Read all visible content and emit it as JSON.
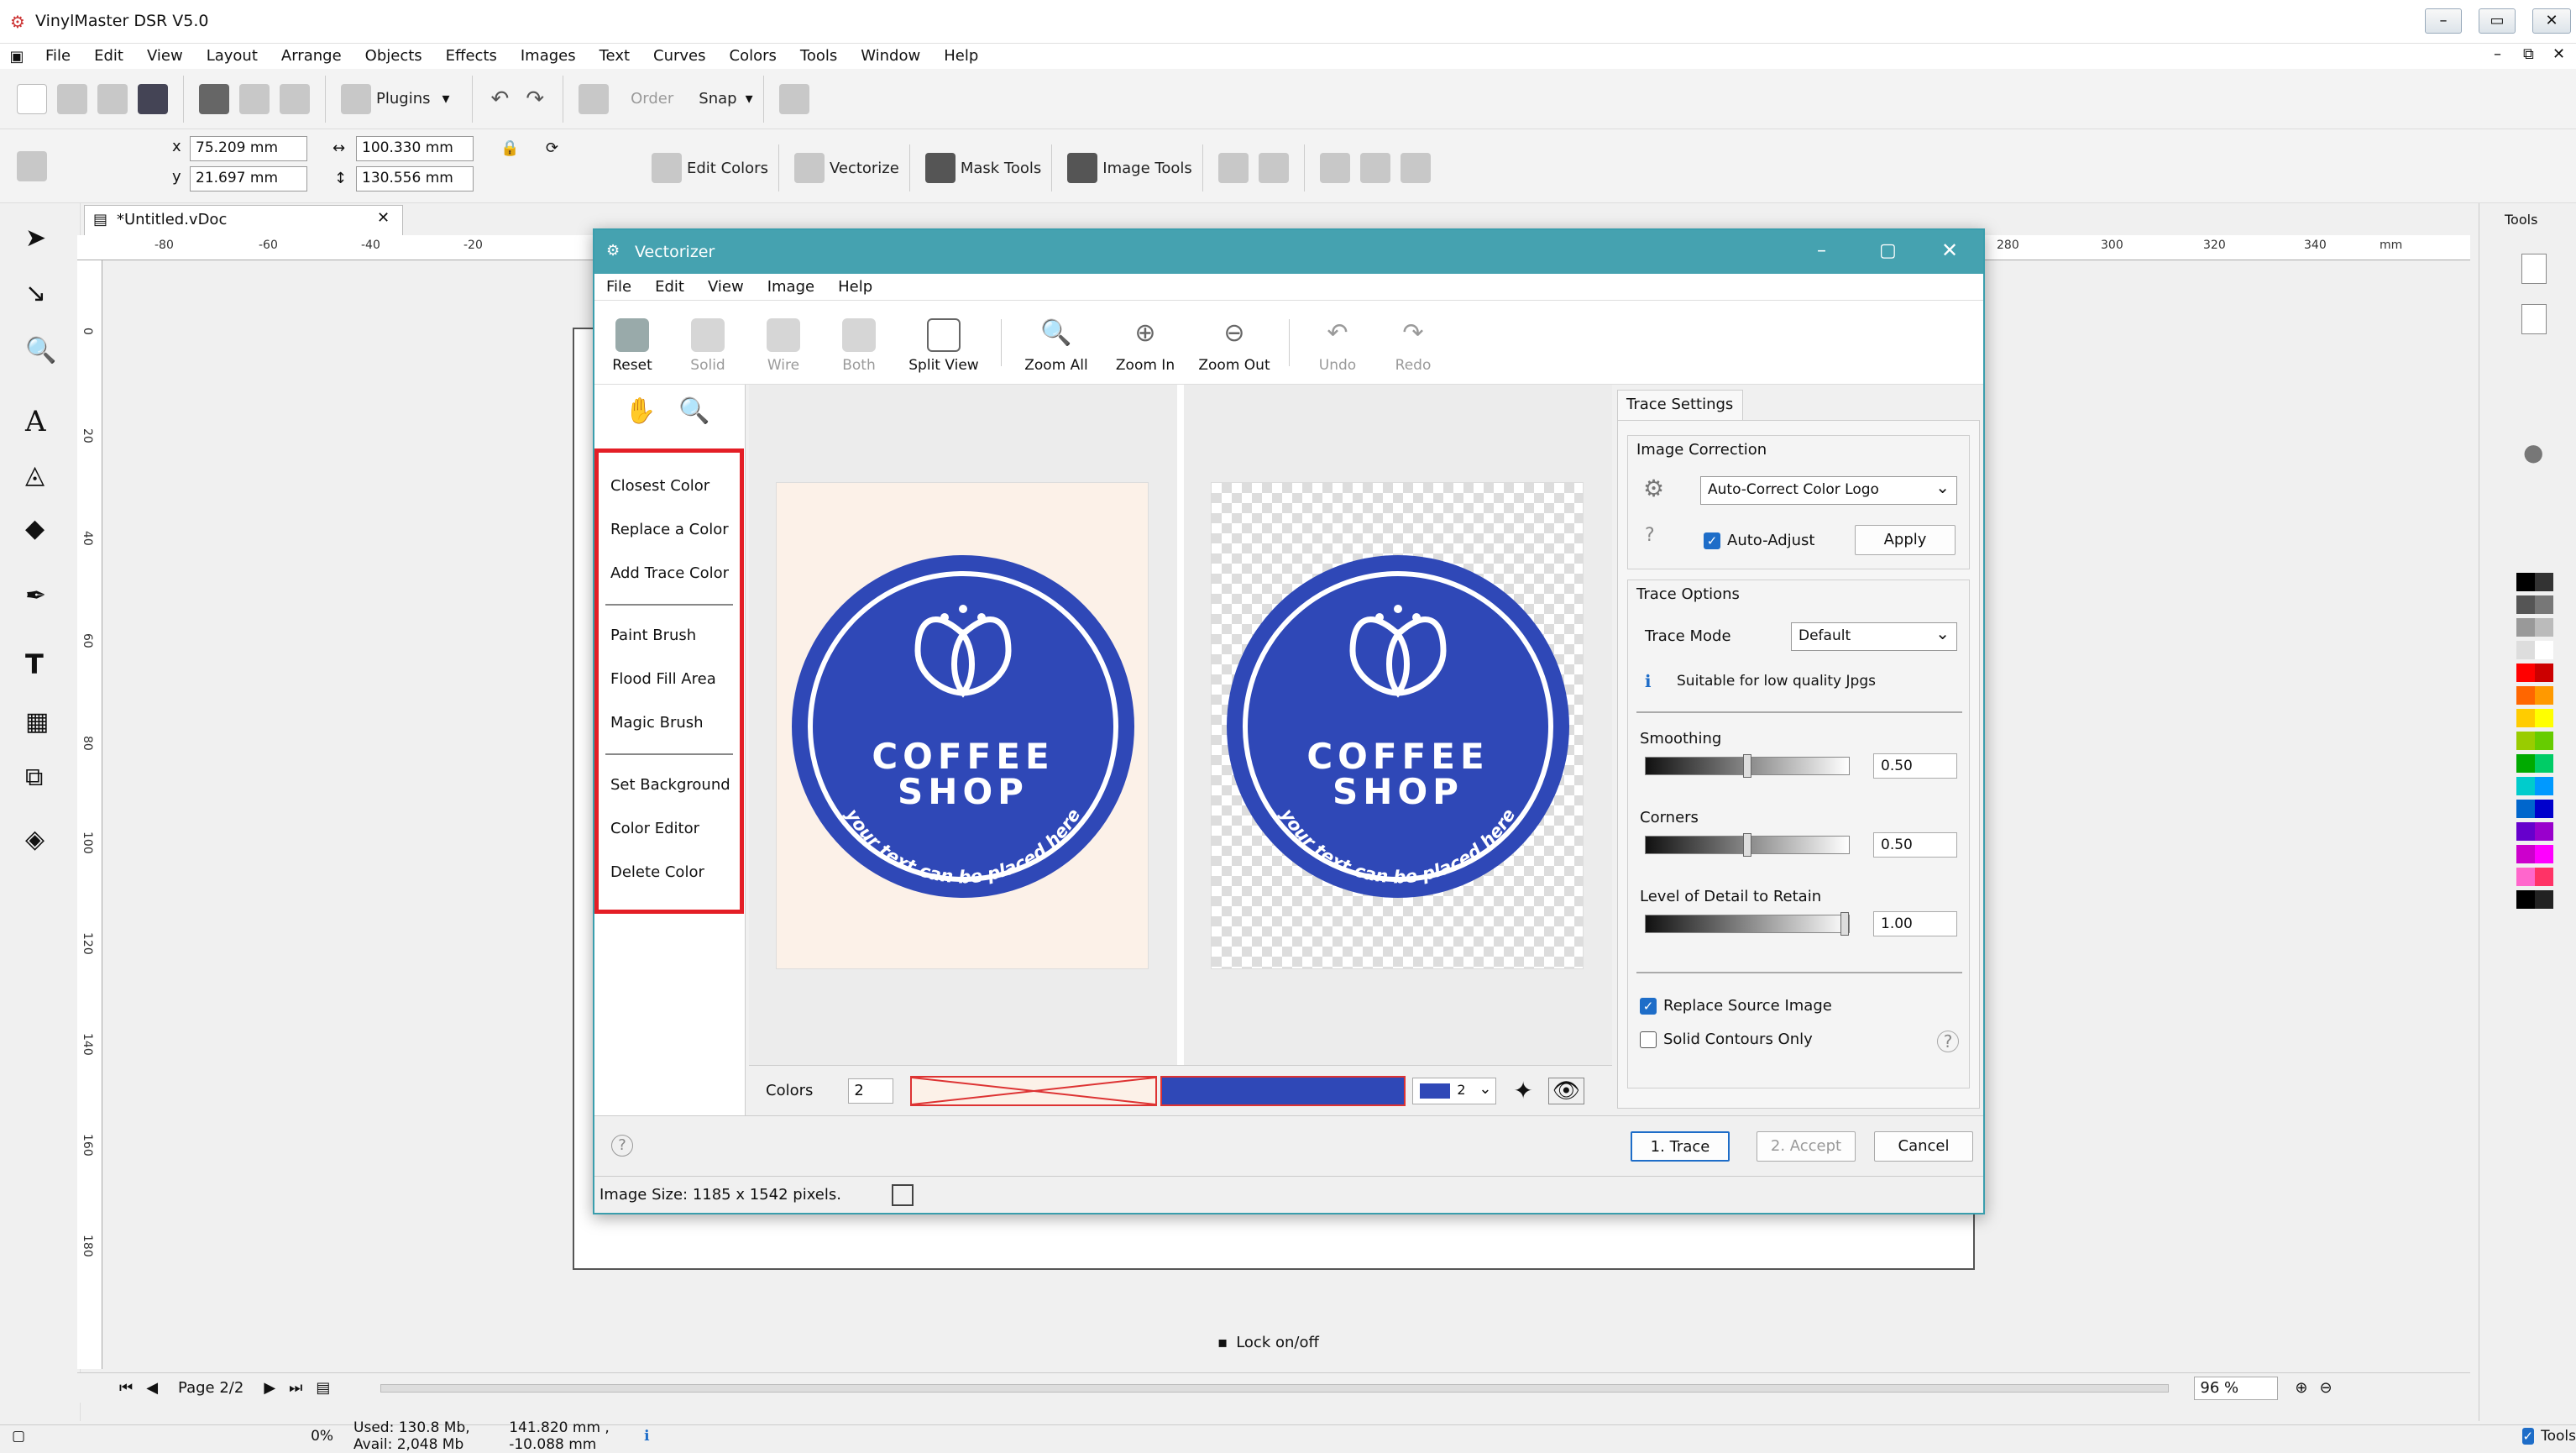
{
  "app": {
    "title": "VinylMaster DSR V5.0"
  },
  "menus": [
    "File",
    "Edit",
    "View",
    "Layout",
    "Arrange",
    "Objects",
    "Effects",
    "Images",
    "Text",
    "Curves",
    "Colors",
    "Tools",
    "Window",
    "Help"
  ],
  "toolbar1": {
    "plugins": "Plugins",
    "order": "Order",
    "snap": "Snap"
  },
  "toolbar2": {
    "x_label": "x",
    "y_label": "y",
    "x_value": "75.209 mm",
    "y_value": "21.697 mm",
    "w_value": "100.330 mm",
    "h_value": "130.556 mm",
    "edit_colors": "Edit Colors",
    "vectorize": "Vectorize",
    "mask_tools": "Mask Tools",
    "image_tools": "Image Tools"
  },
  "document": {
    "tab": "*Untitled.vDoc",
    "page_nav": "Page 2/2",
    "lock_label": "Lock on/off",
    "zoom": "96 %",
    "ruler_ticks": [
      "-80",
      "-60",
      "-40",
      "-20",
      "280",
      "300",
      "320",
      "340"
    ],
    "ruler_unit": "mm",
    "vruler_ticks": [
      "0",
      "20",
      "40",
      "60",
      "80",
      "100",
      "120",
      "140",
      "160",
      "180"
    ]
  },
  "dialog": {
    "title": "Vectorizer",
    "menus": [
      "File",
      "Edit",
      "View",
      "Image",
      "Help"
    ],
    "tools": [
      {
        "label": "Reset",
        "enabled": true
      },
      {
        "label": "Solid",
        "enabled": false
      },
      {
        "label": "Wire",
        "enabled": false
      },
      {
        "label": "Both",
        "enabled": false
      },
      {
        "label": "Split View",
        "enabled": true
      },
      {
        "label": "Zoom All",
        "enabled": true
      },
      {
        "label": "Zoom In",
        "enabled": true
      },
      {
        "label": "Zoom Out",
        "enabled": true
      },
      {
        "label": "Undo",
        "enabled": false
      },
      {
        "label": "Redo",
        "enabled": false
      }
    ],
    "tool_groups": [
      [
        "Closest Color",
        "Replace a Color",
        "Add Trace Color"
      ],
      [
        "Paint Brush",
        "Flood Fill Area",
        "Magic Brush"
      ],
      [
        "Set Background",
        "Color Editor",
        "Delete Color"
      ]
    ],
    "logo": {
      "line1": "COFFEE",
      "line2": "SHOP",
      "arc": "your text can be placed here",
      "color": "#2f48b7",
      "bg": "#fcf1e8"
    },
    "colors_label": "Colors",
    "colors_count": "2",
    "swatch_count": "2",
    "settings_tab": "Trace Settings",
    "image_correction": {
      "title": "Image Correction",
      "mode": "Auto-Correct Color Logo",
      "auto_adjust": "Auto-Adjust",
      "apply": "Apply"
    },
    "trace_options": {
      "title": "Trace Options",
      "mode_label": "Trace Mode",
      "mode": "Default",
      "hint": "Suitable for low quality Jpgs"
    },
    "smoothing": {
      "label": "Smoothing",
      "value": "0.50",
      "level": 0.5
    },
    "corners": {
      "label": "Corners",
      "value": "0.50",
      "level": 0.5
    },
    "detail": {
      "label": "Level of Detail to Retain",
      "value": "1.00",
      "level": 1.0
    },
    "replace_source": "Replace Source Image",
    "solid_contours": "Solid Contours Only",
    "buttons": {
      "trace": "1. Trace",
      "accept": "2. Accept",
      "cancel": "Cancel"
    },
    "status": "Image Size: 1185 x 1542 pixels."
  },
  "statusbar": {
    "percent": "0%",
    "memory": "Used: 130.8 Mb, Avail: 2,048 Mb",
    "coords": "141.820 mm , -10.088 mm",
    "tools": "Tools"
  },
  "right_panel": {
    "label": "Tools"
  },
  "palette": [
    "#000000",
    "#333333",
    "#555555",
    "#777777",
    "#999999",
    "#bbbbbb",
    "#dddddd",
    "#ffffff",
    "#ff0000",
    "#cc0000",
    "#ff6600",
    "#ff9900",
    "#ffcc00",
    "#ffff00",
    "#99cc00",
    "#66cc00",
    "#00aa00",
    "#00cc66",
    "#00cccc",
    "#0099ff",
    "#0066cc",
    "#0000cc",
    "#6600cc",
    "#9900cc",
    "#cc00cc",
    "#ff00ff",
    "#ff66cc",
    "#ff3366",
    "#000000",
    "#222222"
  ]
}
